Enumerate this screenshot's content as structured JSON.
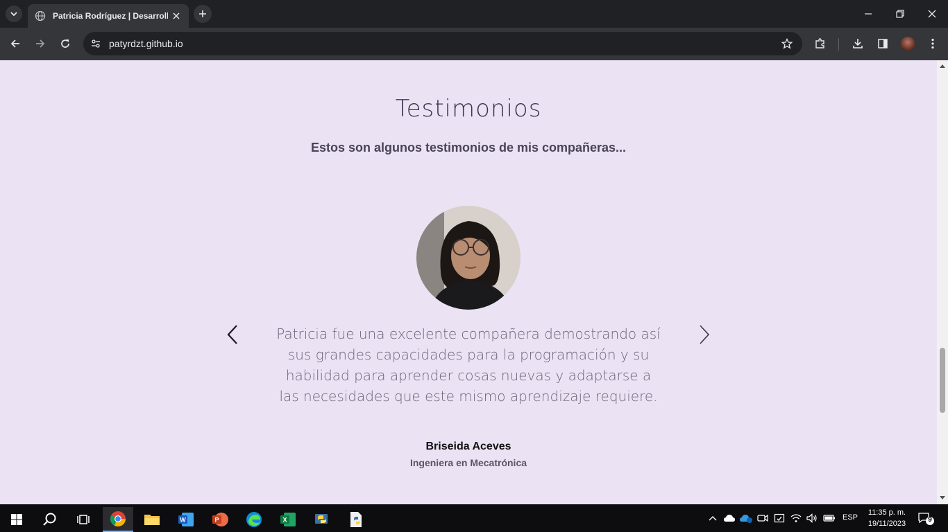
{
  "browser": {
    "tab_title": "Patricia Rodríguez | Desarrollo",
    "url": "patyrdzt.github.io"
  },
  "section": {
    "heading": "Testimonios",
    "subheading": "Estos son algunos testimonios de mis compañeras..."
  },
  "testimonial": {
    "quote": "Patricia fue una excelente compañera demostrando así sus grandes capacidades para la programación y su habilidad para aprender cosas nuevas y adaptarse a las necesidades que este mismo aprendizaje requiere.",
    "author": "Briseida Aceves",
    "role": "Ingeniera en Mecatrónica"
  },
  "taskbar": {
    "language": "ESP",
    "time": "11:35 p. m.",
    "date": "19/11/2023",
    "notification_count": "9"
  },
  "colors": {
    "page_bg": "#ebe3f4",
    "browser_dark": "#202124",
    "toolbar": "#35363a"
  }
}
